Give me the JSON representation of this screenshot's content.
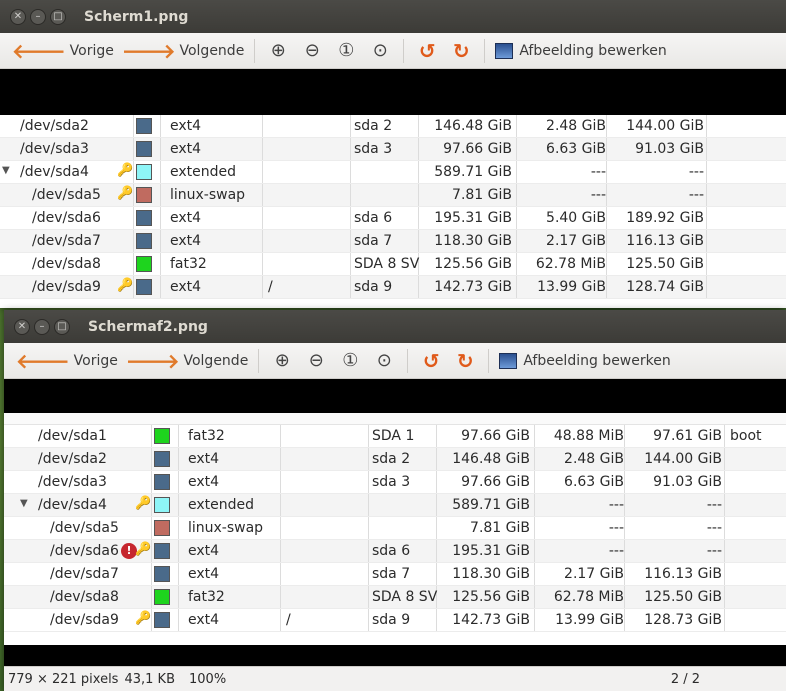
{
  "window1": {
    "title": "Scherm1.png",
    "rows": [
      {
        "dev": "/dev/sda2",
        "color": "#4a6a8a",
        "fs": "ext4",
        "mount": "",
        "label": "sda 2",
        "size": "146.48 GiB",
        "used": "2.48 GiB",
        "free": "144.00 GiB",
        "flags": "",
        "key": false,
        "indent": 0
      },
      {
        "dev": "/dev/sda3",
        "color": "#4a6a8a",
        "fs": "ext4",
        "mount": "",
        "label": "sda 3",
        "size": "97.66 GiB",
        "used": "6.63 GiB",
        "free": "91.03 GiB",
        "flags": "",
        "key": false,
        "indent": 0
      },
      {
        "dev": "/dev/sda4",
        "color": "#8ef5f7",
        "fs": "extended",
        "mount": "",
        "label": "",
        "size": "589.71 GiB",
        "used": "---",
        "free": "---",
        "flags": "",
        "key": true,
        "indent": 0,
        "expander": true
      },
      {
        "dev": "/dev/sda5",
        "color": "#c06b60",
        "fs": "linux-swap",
        "mount": "",
        "label": "",
        "size": "7.81 GiB",
        "used": "---",
        "free": "---",
        "flags": "",
        "key": true,
        "indent": 1
      },
      {
        "dev": "/dev/sda6",
        "color": "#4a6a8a",
        "fs": "ext4",
        "mount": "",
        "label": "sda 6",
        "size": "195.31 GiB",
        "used": "5.40 GiB",
        "free": "189.92 GiB",
        "flags": "",
        "key": false,
        "indent": 1
      },
      {
        "dev": "/dev/sda7",
        "color": "#4a6a8a",
        "fs": "ext4",
        "mount": "",
        "label": "sda 7",
        "size": "118.30 GiB",
        "used": "2.17 GiB",
        "free": "116.13 GiB",
        "flags": "",
        "key": false,
        "indent": 1
      },
      {
        "dev": "/dev/sda8",
        "color": "#1ed41e",
        "fs": "fat32",
        "mount": "",
        "label": "SDA 8 SV",
        "size": "125.56 GiB",
        "used": "62.78 MiB",
        "free": "125.50 GiB",
        "flags": "",
        "key": false,
        "indent": 1
      },
      {
        "dev": "/dev/sda9",
        "color": "#4a6a8a",
        "fs": "ext4",
        "mount": "/",
        "label": "sda 9",
        "size": "142.73 GiB",
        "used": "13.99 GiB",
        "free": "128.74 GiB",
        "flags": "",
        "key": true,
        "indent": 1
      }
    ]
  },
  "window2": {
    "title": "Schermaf2.png",
    "rows": [
      {
        "dev": "/dev/sda1",
        "color": "#1ed41e",
        "fs": "fat32",
        "mount": "",
        "label": "SDA 1",
        "size": "97.66 GiB",
        "used": "48.88 MiB",
        "free": "97.61 GiB",
        "flags": "boot",
        "key": false,
        "indent": 0
      },
      {
        "dev": "/dev/sda2",
        "color": "#4a6a8a",
        "fs": "ext4",
        "mount": "",
        "label": "sda 2",
        "size": "146.48 GiB",
        "used": "2.48 GiB",
        "free": "144.00 GiB",
        "flags": "",
        "key": false,
        "indent": 0
      },
      {
        "dev": "/dev/sda3",
        "color": "#4a6a8a",
        "fs": "ext4",
        "mount": "",
        "label": "sda 3",
        "size": "97.66 GiB",
        "used": "6.63 GiB",
        "free": "91.03 GiB",
        "flags": "",
        "key": false,
        "indent": 0
      },
      {
        "dev": "/dev/sda4",
        "color": "#8ef5f7",
        "fs": "extended",
        "mount": "",
        "label": "",
        "size": "589.71 GiB",
        "used": "---",
        "free": "---",
        "flags": "",
        "key": true,
        "indent": 0,
        "expander": true
      },
      {
        "dev": "/dev/sda5",
        "color": "#c06b60",
        "fs": "linux-swap",
        "mount": "",
        "label": "",
        "size": "7.81 GiB",
        "used": "---",
        "free": "---",
        "flags": "",
        "key": false,
        "indent": 1
      },
      {
        "dev": "/dev/sda6",
        "color": "#4a6a8a",
        "fs": "ext4",
        "mount": "",
        "label": "sda 6",
        "size": "195.31 GiB",
        "used": "---",
        "free": "---",
        "flags": "",
        "key": true,
        "warn": true,
        "indent": 1
      },
      {
        "dev": "/dev/sda7",
        "color": "#4a6a8a",
        "fs": "ext4",
        "mount": "",
        "label": "sda 7",
        "size": "118.30 GiB",
        "used": "2.17 GiB",
        "free": "116.13 GiB",
        "flags": "",
        "key": false,
        "indent": 1
      },
      {
        "dev": "/dev/sda8",
        "color": "#1ed41e",
        "fs": "fat32",
        "mount": "",
        "label": "SDA 8 SV",
        "size": "125.56 GiB",
        "used": "62.78 MiB",
        "free": "125.50 GiB",
        "flags": "",
        "key": false,
        "indent": 1
      },
      {
        "dev": "/dev/sda9",
        "color": "#4a6a8a",
        "fs": "ext4",
        "mount": "/",
        "label": "sda 9",
        "size": "142.73 GiB",
        "used": "13.99 GiB",
        "free": "128.73 GiB",
        "flags": "",
        "key": true,
        "indent": 1
      }
    ]
  },
  "toolbar": {
    "prev_label": "Vorige",
    "next_label": "Volgende",
    "edit_label": "Afbeelding bewerken"
  },
  "status": {
    "dimensions": "779 × 221 pixels",
    "filesize": "43,1 KB",
    "zoom": "100%",
    "page": "2 / 2"
  }
}
